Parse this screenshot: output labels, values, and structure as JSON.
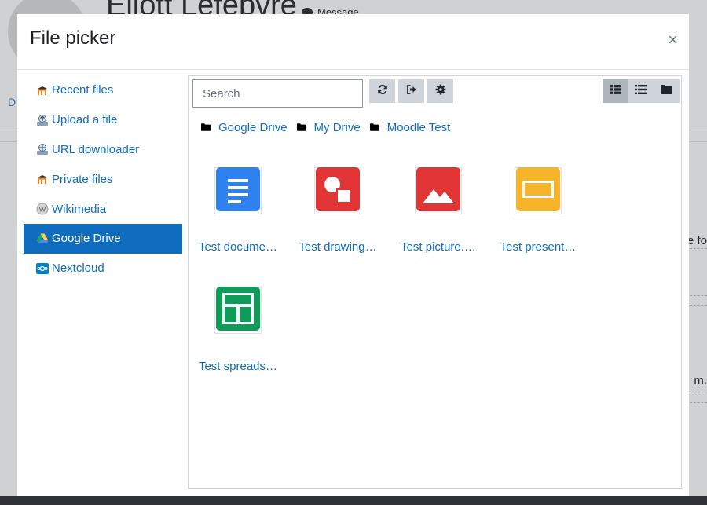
{
  "background": {
    "user_name": "Eliott Lefebvre",
    "message_label": "Message",
    "left_letter": "D",
    "right_text_1": "e fo",
    "right_text_2": "m."
  },
  "modal": {
    "title": "File picker",
    "close_symbol": "×"
  },
  "repositories": [
    {
      "label": "Recent files",
      "icon": "moodle-icon",
      "active": false
    },
    {
      "label": "Upload a file",
      "icon": "upload-icon",
      "active": false
    },
    {
      "label": "URL downloader",
      "icon": "url-icon",
      "active": false
    },
    {
      "label": "Private files",
      "icon": "moodle-icon",
      "active": false
    },
    {
      "label": "Wikimedia",
      "icon": "wikimedia-icon",
      "active": false
    },
    {
      "label": "Google Drive",
      "icon": "google-drive-icon",
      "active": true
    },
    {
      "label": "Nextcloud",
      "icon": "nextcloud-icon",
      "active": false
    }
  ],
  "toolbar": {
    "search_placeholder": "Search",
    "refresh_icon": "refresh-icon",
    "logout_icon": "logout-icon",
    "settings_icon": "gear-icon",
    "views": [
      {
        "name": "icons-view",
        "icon": "grid-icon",
        "active": true
      },
      {
        "name": "list-view",
        "icon": "list-icon",
        "active": false
      },
      {
        "name": "tree-view",
        "icon": "folder-icon",
        "active": false
      }
    ]
  },
  "breadcrumb": [
    "Google Drive",
    "My Drive",
    "Moodle Test"
  ],
  "files": [
    {
      "name": "Test document",
      "display": "Test docume…",
      "type": "document",
      "color": "#2e82f0"
    },
    {
      "name": "Test drawing",
      "display": "Test drawing…",
      "type": "drawing",
      "color": "#e23535"
    },
    {
      "name": "Test picture",
      "display": "Test picture.…",
      "type": "picture",
      "color": "#e23535"
    },
    {
      "name": "Test presentation",
      "display": "Test present…",
      "type": "presentation",
      "color": "#f6b42a"
    },
    {
      "name": "Test spreadsheet",
      "display": "Test spreads…",
      "type": "spreadsheet",
      "color": "#0e9d58"
    }
  ]
}
